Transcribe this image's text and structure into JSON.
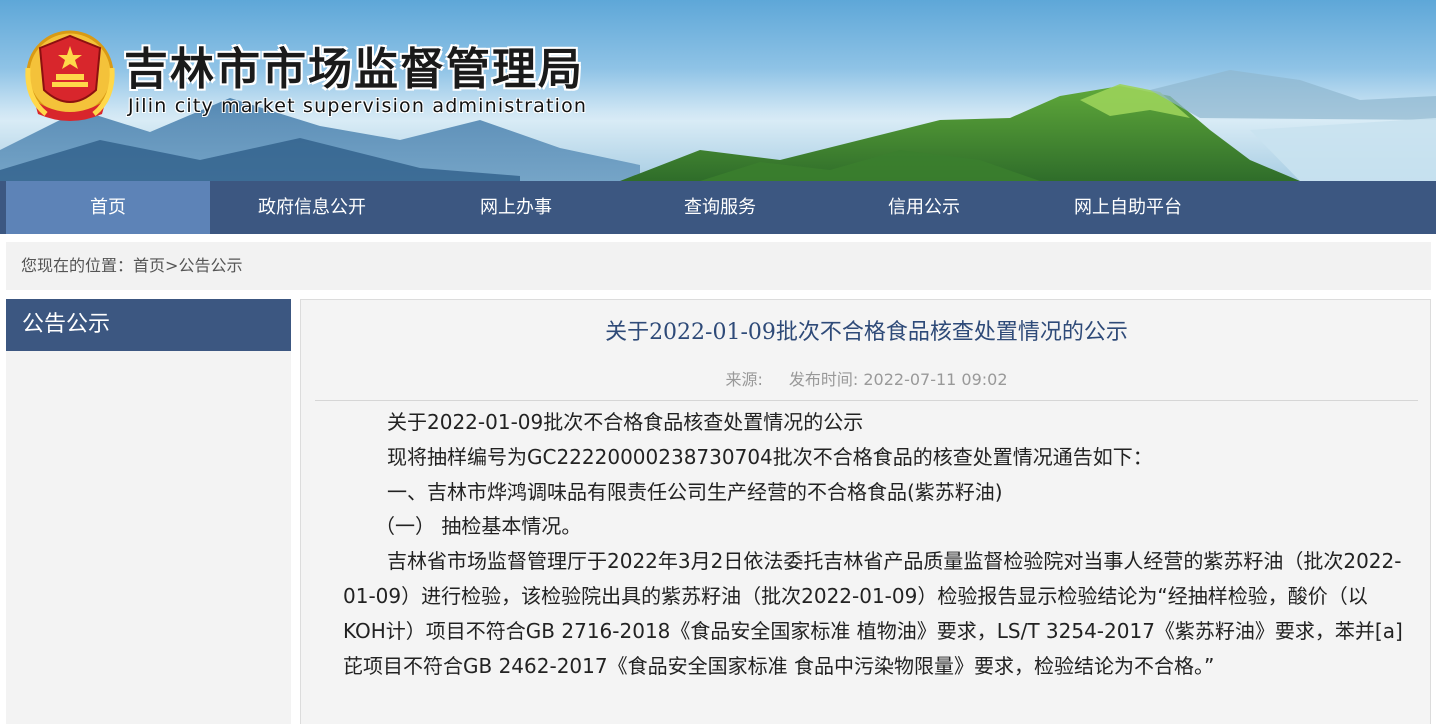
{
  "header": {
    "site_title": "吉林市市场监督管理局",
    "site_subtitle": "Jilin city market supervision administration"
  },
  "nav": {
    "items": [
      "首页",
      "政府信息公开",
      "网上办事",
      "查询服务",
      "信用公示",
      "网上自助平台"
    ]
  },
  "breadcrumb": {
    "prefix": "您现在的位置：",
    "home": "首页",
    "separator": ">",
    "current": "公告公示"
  },
  "sidebar": {
    "title": "公告公示"
  },
  "article": {
    "title": "关于2022-01-09批次不合格食品核查处置情况的公示",
    "source_label": "来源:",
    "publish_label": "发布时间:",
    "publish_time": "2022-07-11 09:02",
    "paragraphs": [
      "关于2022-01-09批次不合格食品核查处置情况的公示",
      "现将抽样编号为GC22220000238730704批次不合格食品的核查处置情况通告如下：",
      "一、吉林市烨鸿调味品有限责任公司生产经营的不合格食品(紫苏籽油)",
      "（一） 抽检基本情况。",
      "吉林省市场监督管理厅于2022年3月2日依法委托吉林省产品质量监督检验院对当事人经营的紫苏籽油（批次2022-01-09）进行检验，该检验院出具的紫苏籽油（批次2022-01-09）检验报告显示检验结论为“经抽样检验，酸价（以KOH计）项目不符合GB 2716-2018《食品安全国家标准 植物油》要求，LS/T 3254-2017《紫苏籽油》要求，苯并[a]芘项目不符合GB 2462-2017《食品安全国家标准 食品中污染物限量》要求，检验结论为不合格。”"
    ]
  },
  "colors": {
    "nav_bg": "#3c5781",
    "nav_active": "#5d83b7",
    "title_color": "#2e4a78"
  }
}
